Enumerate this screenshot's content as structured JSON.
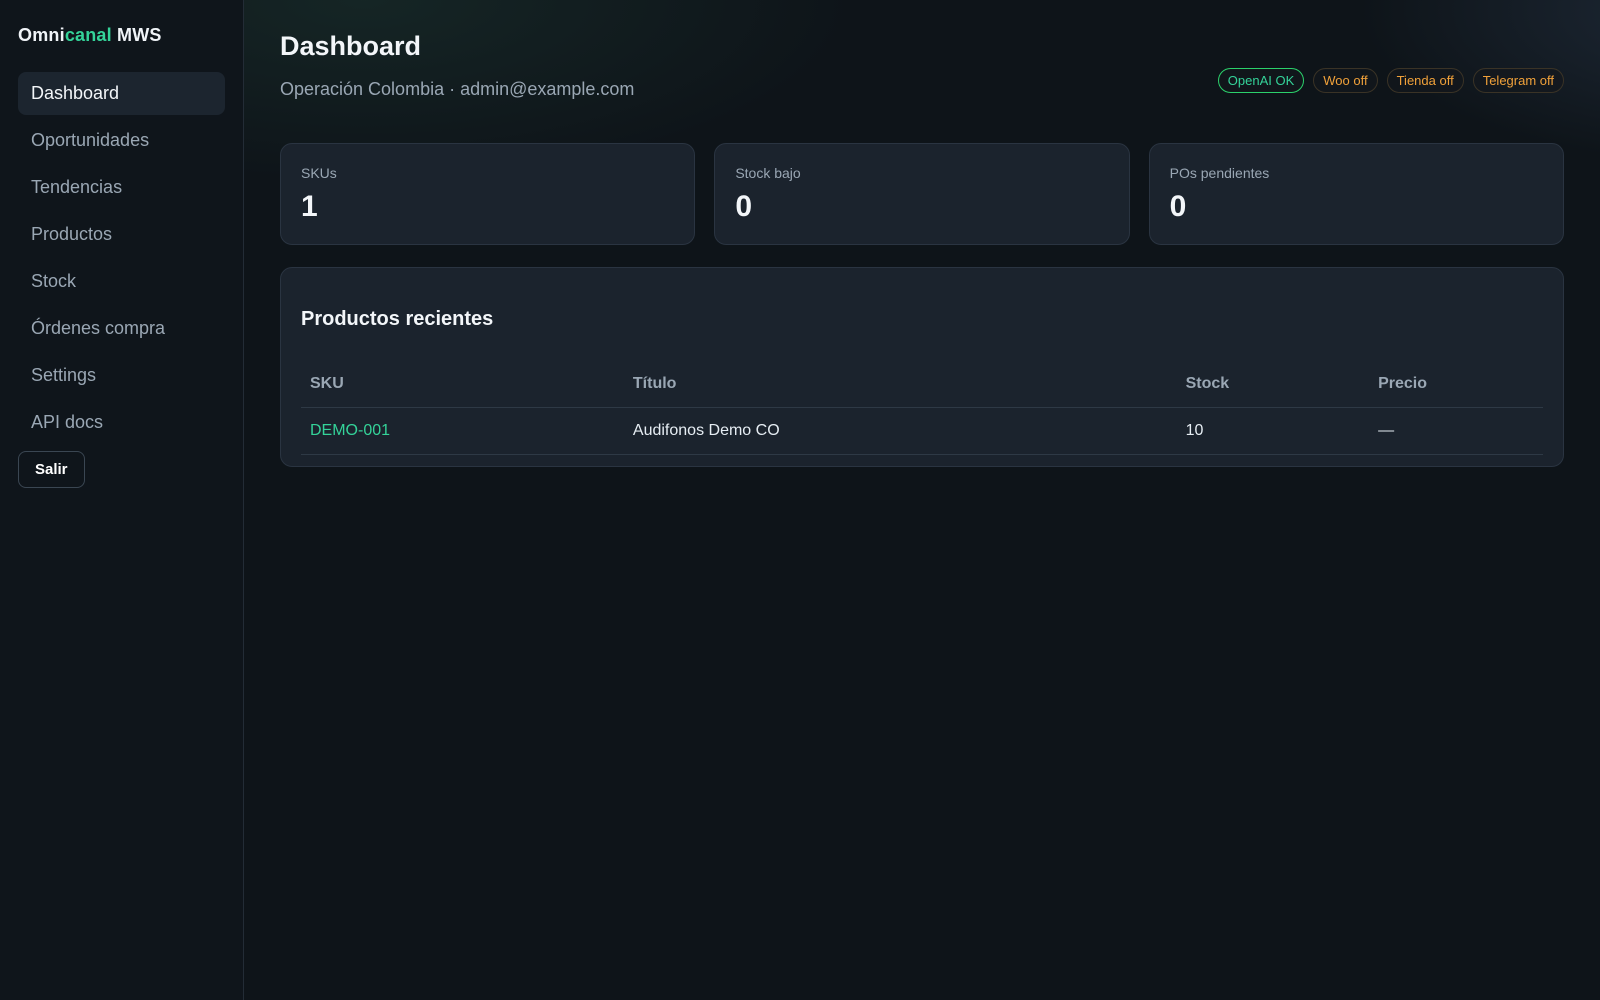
{
  "brand": {
    "part1": "Omni",
    "part2": "canal",
    "part3": " MWS"
  },
  "sidebar": {
    "items": [
      {
        "label": "Dashboard"
      },
      {
        "label": "Oportunidades"
      },
      {
        "label": "Tendencias"
      },
      {
        "label": "Productos"
      },
      {
        "label": "Stock"
      },
      {
        "label": "Órdenes compra"
      },
      {
        "label": "Settings"
      },
      {
        "label": "API docs"
      }
    ],
    "logout_label": "Salir",
    "active_index": 0
  },
  "header": {
    "title": "Dashboard",
    "subtitle": "Operación Colombia · admin@example.com"
  },
  "badges": [
    {
      "label": "OpenAI OK",
      "status": "ok"
    },
    {
      "label": "Woo off",
      "status": "off"
    },
    {
      "label": "Tienda off",
      "status": "off"
    },
    {
      "label": "Telegram off",
      "status": "off"
    }
  ],
  "stats": [
    {
      "label": "SKUs",
      "value": "1"
    },
    {
      "label": "Stock bajo",
      "value": "0"
    },
    {
      "label": "POs pendientes",
      "value": "0"
    }
  ],
  "recent_products": {
    "title": "Productos recientes",
    "columns": [
      "SKU",
      "Título",
      "Stock",
      "Precio"
    ],
    "rows": [
      {
        "sku": "DEMO-001",
        "title": "Audifonos Demo CO",
        "stock": "10",
        "price": "—"
      }
    ]
  },
  "colors": {
    "accent": "#34d399",
    "warning": "#f0a13a",
    "background": "#0e1419",
    "card": "#1b232d"
  }
}
